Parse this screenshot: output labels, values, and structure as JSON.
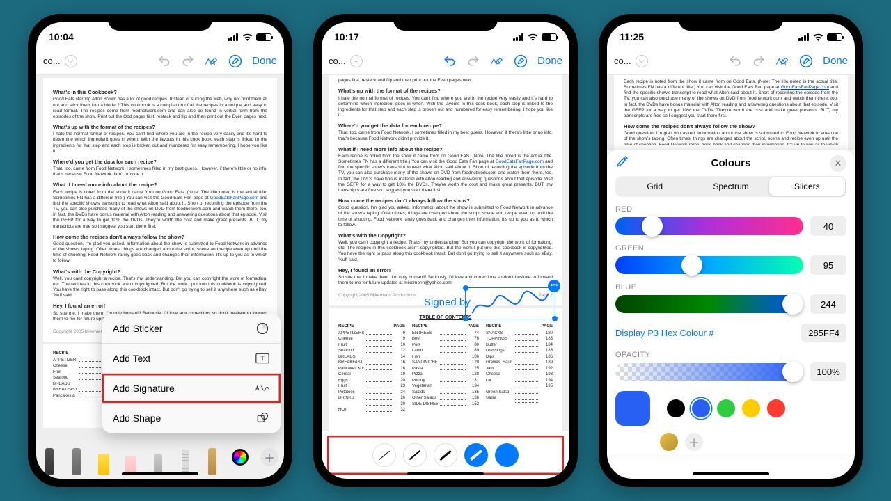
{
  "phones": [
    {
      "time": "10:04"
    },
    {
      "time": "10:17"
    },
    {
      "time": "11:25"
    }
  ],
  "topbar": {
    "title": "co...",
    "done": "Done"
  },
  "menu": {
    "sticker": "Add Sticker",
    "text": "Add Text",
    "signature": "Add Signature",
    "shape": "Add Shape"
  },
  "signature": {
    "label": "Signed by"
  },
  "colours": {
    "title": "Colours",
    "tabs": {
      "grid": "Grid",
      "spectrum": "Spectrum",
      "sliders": "Sliders"
    },
    "red": {
      "label": "RED",
      "value": "40"
    },
    "green": {
      "label": "GREEN",
      "value": "95"
    },
    "blue": {
      "label": "BLUE",
      "value": "244"
    },
    "hex": {
      "label": "Display P3 Hex Colour #",
      "value": "285FF4"
    },
    "opacity": {
      "label": "OPACITY",
      "value": "100%"
    }
  },
  "doc": {
    "h1": "What's in this Cookbook?",
    "p1": "Good Eats starring Alton Brown has a lot of good recipes. Instead of surfing the web, why not print them all out and stick them into a binder? This cookbook is a compilation of all the recipes in a unique and easy to read format. The recipes come from foodnetwork.com and can also be found in verbal form from the episodes of the show. Print out the Odd pages first, restack and flip and then print out the Even pages next.",
    "h2": "What's up with the format of the recipes?",
    "p2": "I hate the normal format of recipes. You can't find where you are in the recipe very easily and it's hard to determine which ingredient goes in when. With the layouts in this cook book, each step is linked to the ingredients for that step and each step is broken out and numbered for easy remembering. I hope you like it.",
    "h3": "Where'd you get the data for each recipe?",
    "p3": "That, too, came from Food Network. I sometimes filled in my best guess. However, if there's little or no info, that's because Food Network didn't provide it.",
    "h4": "What if I need more info about the recipe?",
    "p4a": "Each recipe is noted from the show it came from on Good Eats. (Note: The title noted is the actual title. Sometimes FN has a different title.) You can visit the Good Eats Fan page at ",
    "p4link": "GoodEatsFanPage.com",
    "p4b": " and find the specific show's transcript to read what Alton said about it. Short of recording the episode from the TV, you can also purchase many of the shows on DVD from foodnetwork.com and watch them there, too. In fact, the DVDs have bonus material with Alton reading and answering questions about that episode. Visit the GEFP for a way to get 10% the DVDs. They're worth the cost and make great presents. BUT, my transcripts are free so I suggest you start there first.",
    "h5": "How come the recipes don't always follow the show?",
    "p5": "Good question. I'm glad you asked. Information about the show is submitted to Food Network in advance of the show's taping. Often times, things are changed about the script, scene and recipe even up until the time of shooting. Food Network rarely goes back and changes their information. It's up to you as to which to follow.",
    "h6": "What's with the Copyright?",
    "p6": "Well, you can't copyright a recipe. That's my understanding. But you can copyright the work of formatting, etc. The recipes in this cookbook aren't copyrighted. But the work I put into this cookbook is copyrighted. You have the right to pass along this cookbook intact. But don't go trying to sell it anywhere such as eBay. 'Nuff said.",
    "h7": "Hey, I found an error!",
    "p7": "So sue me. I make them. I'm only human!!! Seriously, I'd love any corrections so don't hesitate to forward them to me for future updates at mikemenn@yahoo.com.",
    "foot_l": "Copyright 2005 Mikemenn Productions",
    "foot_r": "Page 2",
    "toc": "TABLE OF CONTENTS"
  },
  "toc": {
    "cols": [
      {
        "head": "RECIPE",
        "page": "PAGE",
        "rows": [
          {
            "n": "APPETIZERS",
            "p": "9"
          },
          {
            "n": "Cheese",
            "p": "9"
          },
          {
            "n": "Fruit",
            "p": "10"
          },
          {
            "n": "Seafood",
            "p": "12"
          },
          {
            "n": "BREADS",
            "p": "14"
          },
          {
            "n": "BREAKFAST",
            "p": "16"
          },
          {
            "n": "Pancakes & Waffles",
            "p": "16"
          },
          {
            "n": "Cereal",
            "p": "19"
          },
          {
            "n": "Eggs",
            "p": "20"
          },
          {
            "n": "Fruit",
            "p": "23"
          },
          {
            "n": "Potatoes",
            "p": "24"
          },
          {
            "n": "DRINKS",
            "p": "26"
          },
          {
            "n": "",
            "p": "30"
          },
          {
            "n": "HOT",
            "p": "32"
          }
        ]
      },
      {
        "head": "RECIPE",
        "page": "PAGE",
        "rows": [
          {
            "n": "ENTREES",
            "p": "74"
          },
          {
            "n": "Beef",
            "p": "76"
          },
          {
            "n": "Pork",
            "p": "80"
          },
          {
            "n": "Lamb",
            "p": "89"
          },
          {
            "n": "Fish",
            "p": "106"
          },
          {
            "n": "SANDWICHES",
            "p": "120"
          },
          {
            "n": "Pasta",
            "p": "125"
          },
          {
            "n": "Pizza",
            "p": "128"
          },
          {
            "n": "Poultry",
            "p": "131"
          },
          {
            "n": "Vegetarian",
            "p": "134"
          },
          {
            "n": "Salads",
            "p": "135"
          },
          {
            "n": "Other Salads",
            "p": "136"
          },
          {
            "n": "SIDE DISHES",
            "p": "152"
          }
        ]
      },
      {
        "head": "RECIPE",
        "page": "PAGE",
        "rows": [
          {
            "n": "SNACKS",
            "p": "180"
          },
          {
            "n": "TOPPINGS",
            "p": "183"
          },
          {
            "n": "Butter",
            "p": "184"
          },
          {
            "n": "Dressings",
            "p": "185"
          },
          {
            "n": "Dips",
            "p": "186"
          },
          {
            "n": "Gravies, Sauces & Rubs",
            "p": "189"
          },
          {
            "n": "Jam",
            "p": "192"
          },
          {
            "n": "Cheese",
            "p": "193"
          },
          {
            "n": "Oil",
            "p": "194"
          },
          {
            "n": "",
            "p": "195"
          },
          {
            "n": "Green Salsa",
            "p": ""
          },
          {
            "n": "Salsa",
            "p": ""
          },
          {
            "n": "",
            "p": ""
          }
        ]
      }
    ]
  }
}
